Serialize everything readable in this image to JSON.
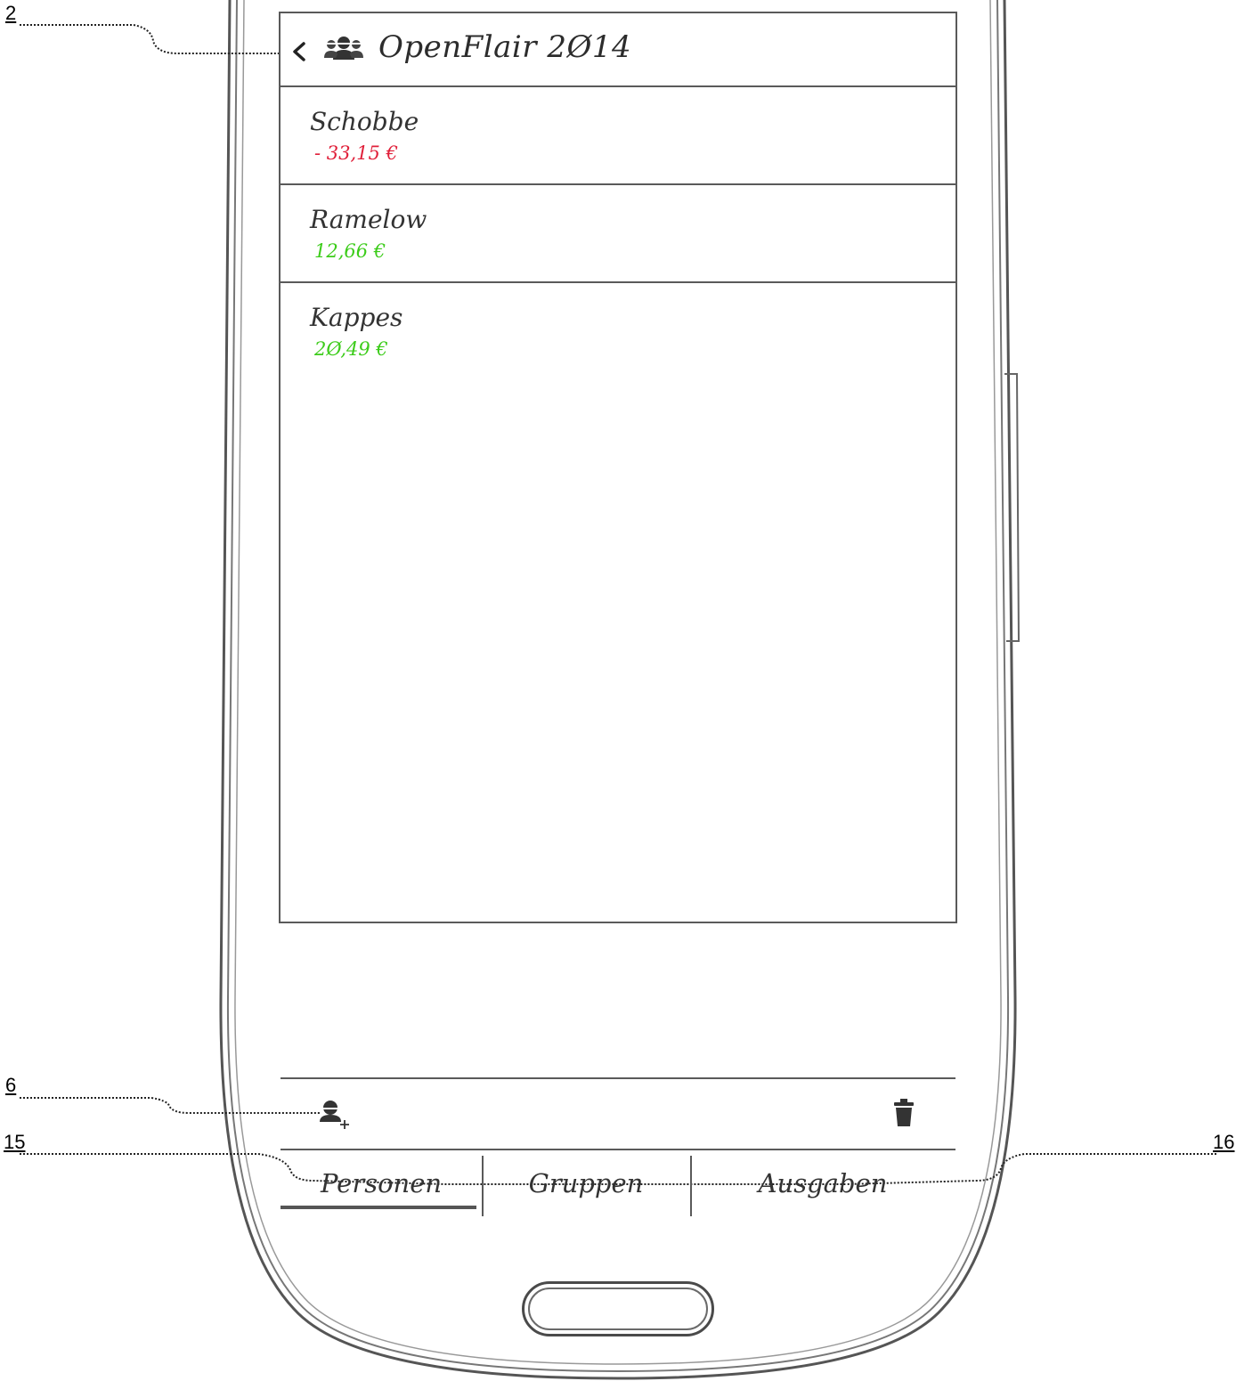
{
  "header": {
    "title": "OpenFlair 2Ø14"
  },
  "persons": [
    {
      "name": "Schobbe",
      "amount": "- 33,15 €",
      "color": "#e0203a"
    },
    {
      "name": "Ramelow",
      "amount": "12,66 €",
      "color": "#3ccc1a"
    },
    {
      "name": "Kappes",
      "amount": "2Ø,49 €",
      "color": "#3ccc1a"
    }
  ],
  "tabs": [
    {
      "label": "Personen",
      "active": true
    },
    {
      "label": "Gruppen",
      "active": false
    },
    {
      "label": "Ausgaben",
      "active": false
    }
  ],
  "callouts": {
    "back": "2",
    "add_person": "6",
    "tabs": "15",
    "expenses": "16"
  },
  "icons": {
    "back": "chevron-left-icon",
    "group": "group-icon",
    "add_person": "add-person-icon",
    "trash": "trash-icon"
  }
}
